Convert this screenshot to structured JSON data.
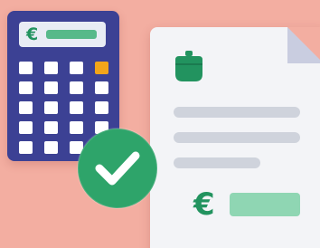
{
  "illustration": {
    "calculator": {
      "display_symbol": "€",
      "accent_key_color": "#f3a51a",
      "body_color": "#3c4194"
    },
    "document": {
      "amount_symbol": "€",
      "wallet_icon": "wallet-icon",
      "accent_color": "#22935f"
    },
    "badge": {
      "icon": "check-icon",
      "color": "#2ea46a"
    },
    "background_color": "#f3aea1"
  }
}
